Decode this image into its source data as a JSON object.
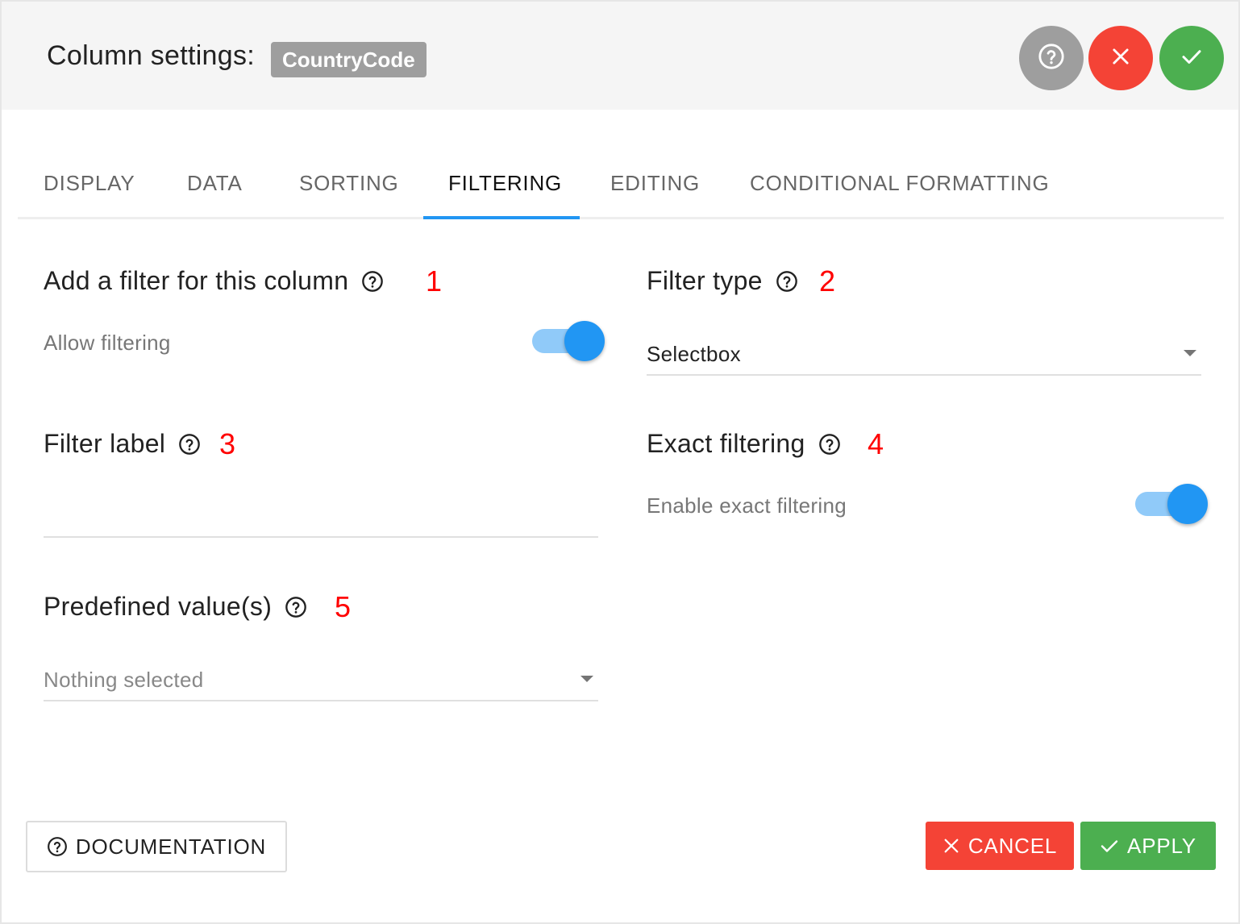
{
  "header": {
    "title": "Column settings:",
    "column_name": "CountryCode"
  },
  "tabs": [
    {
      "label": "DISPLAY"
    },
    {
      "label": "DATA"
    },
    {
      "label": "SORTING"
    },
    {
      "label": "FILTERING"
    },
    {
      "label": "EDITING"
    },
    {
      "label": "CONDITIONAL FORMATTING"
    }
  ],
  "active_tab": "FILTERING",
  "sections": {
    "add_filter": {
      "title": "Add a filter for this column",
      "annotation": "1",
      "toggle_label": "Allow filtering",
      "toggle_on": true
    },
    "filter_type": {
      "title": "Filter type",
      "annotation": "2",
      "selected": "Selectbox"
    },
    "filter_label": {
      "title": "Filter label",
      "annotation": "3",
      "value": ""
    },
    "exact_filtering": {
      "title": "Exact filtering",
      "annotation": "4",
      "toggle_label": "Enable exact filtering",
      "toggle_on": true
    },
    "predefined": {
      "title": "Predefined value(s)",
      "annotation": "5",
      "placeholder": "Nothing selected"
    }
  },
  "footer": {
    "documentation": "DOCUMENTATION",
    "cancel": "CANCEL",
    "apply": "APPLY"
  },
  "colors": {
    "accent": "#2196f3",
    "danger": "#f44336",
    "success": "#4caf50",
    "neutral": "#9e9e9e",
    "annotation": "#ff0000"
  }
}
